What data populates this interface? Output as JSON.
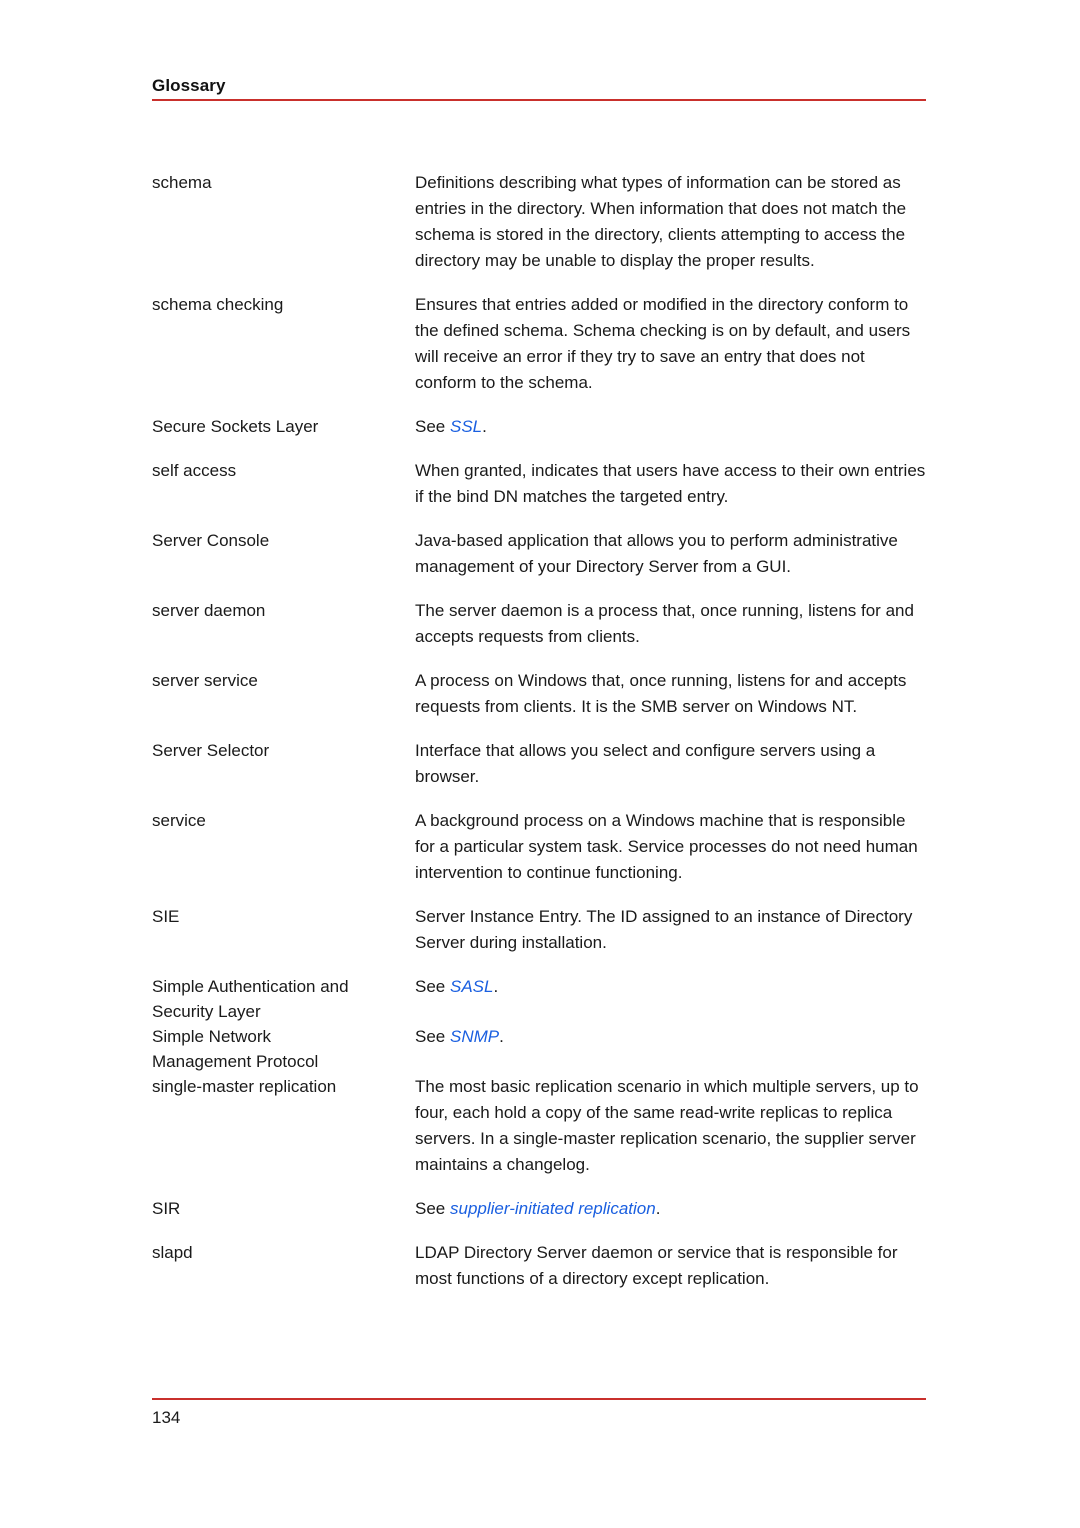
{
  "document": {
    "header_title": "Glossary",
    "page_number": "134",
    "rule_color": "#c9302c",
    "link_color": "#1a5fe0"
  },
  "entries": [
    {
      "term": "schema",
      "definition": "Definitions describing what types of information can be stored as entries in the directory. When information that does not match the schema is stored in the directory, clients attempting to access the directory may be unable to display the proper results.",
      "see_prefix": "",
      "see_link": "",
      "see_suffix": ""
    },
    {
      "term": "schema checking",
      "definition": "Ensures that entries added or modified in the directory conform to the defined schema. Schema checking is on by default, and users will receive an error if they try to save an entry that does not conform to the schema.",
      "see_prefix": "",
      "see_link": "",
      "see_suffix": ""
    },
    {
      "term": "Secure Sockets Layer",
      "definition": "",
      "see_prefix": "See ",
      "see_link": "SSL",
      "see_suffix": "."
    },
    {
      "term": "self access",
      "definition": "When granted, indicates that users have access to their own entries if the bind DN matches the targeted entry.",
      "see_prefix": "",
      "see_link": "",
      "see_suffix": ""
    },
    {
      "term": "Server Console",
      "definition": "Java-based application that allows you to perform administrative management of your Directory Server from a GUI.",
      "see_prefix": "",
      "see_link": "",
      "see_suffix": ""
    },
    {
      "term": "server daemon",
      "definition": "The server daemon is a process that, once running, listens for and accepts requests from clients.",
      "see_prefix": "",
      "see_link": "",
      "see_suffix": ""
    },
    {
      "term": "server service",
      "definition": "A process on Windows that, once running, listens for and accepts requests from clients. It is the SMB server on Windows NT.",
      "see_prefix": "",
      "see_link": "",
      "see_suffix": ""
    },
    {
      "term": "Server Selector",
      "definition": "Interface that allows you select and configure servers using a browser.",
      "see_prefix": "",
      "see_link": "",
      "see_suffix": ""
    },
    {
      "term": "service",
      "definition": "A background process on a Windows machine that is responsible for a particular system task. Service processes do not need human intervention to continue functioning.",
      "see_prefix": "",
      "see_link": "",
      "see_suffix": ""
    },
    {
      "term": "SIE",
      "definition": "Server Instance Entry. The ID assigned to an instance of Directory Server during installation.",
      "see_prefix": "",
      "see_link": "",
      "see_suffix": ""
    },
    {
      "term": "Simple Authentication and\nSecurity Layer",
      "definition": "",
      "see_prefix": "See ",
      "see_link": "SASL",
      "see_suffix": "."
    },
    {
      "term": "Simple Network\nManagement Protocol",
      "definition": "",
      "see_prefix": "See ",
      "see_link": "SNMP",
      "see_suffix": "."
    },
    {
      "term": "single-master replication",
      "definition": "The most basic replication scenario in which multiple servers, up to four, each hold a copy of the same read-write replicas to replica servers. In a single-master replication scenario, the supplier server maintains a changelog.",
      "see_prefix": "",
      "see_link": "",
      "see_suffix": ""
    },
    {
      "term": "SIR",
      "definition": "",
      "see_prefix": "See ",
      "see_link": "supplier-initiated replication",
      "see_suffix": "."
    },
    {
      "term": "slapd",
      "definition": "LDAP Directory Server daemon or service that is responsible for most functions of a directory except replication.",
      "see_prefix": "",
      "see_link": "",
      "see_suffix": ""
    }
  ]
}
